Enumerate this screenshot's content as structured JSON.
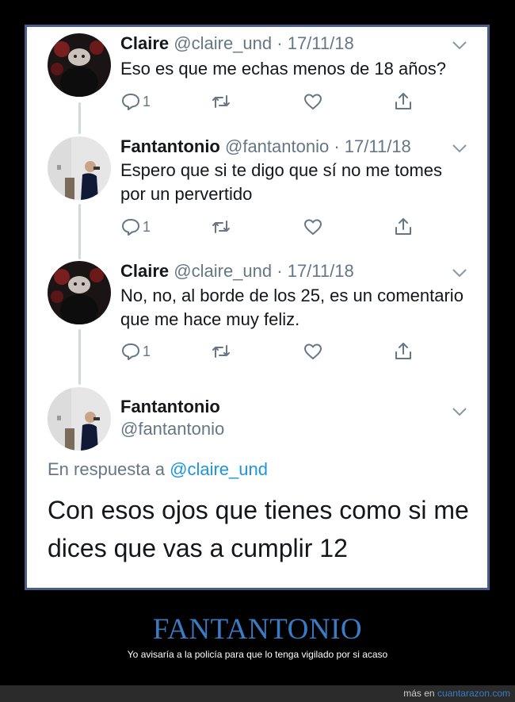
{
  "tweets": [
    {
      "name": "Claire",
      "handle": "@claire_und",
      "date": "· 17/11/18",
      "text": "Eso es que me echas menos de 18 años?",
      "reply_count": "1",
      "avatar": "claire-avatar"
    },
    {
      "name": "Fantantonio",
      "handle": "@fantantonio",
      "date": "· 17/11/18",
      "text": "Espero que si te digo que sí no me tomes por un pervertido",
      "reply_count": "1",
      "avatar": "fantantonio-avatar"
    },
    {
      "name": "Claire",
      "handle": "@claire_und",
      "date": "· 17/11/18",
      "text": "No, no, al borde de los 25, es un comentario que me hace muy feliz.",
      "reply_count": "1",
      "avatar": "claire-avatar"
    }
  ],
  "main_tweet": {
    "name": "Fantantonio",
    "handle": "@fantantonio",
    "reply_prefix": "En respuesta a",
    "reply_mention": "@claire_und",
    "text": "Con esos ojos que tienes como si me dices que vas a cumplir 12"
  },
  "footer": {
    "title": "FANTANTONIO",
    "caption": "Yo avisaría a la policía para que lo tenga vigilado por si acaso",
    "credit_prefix": "más en",
    "credit_site": "cuantarazon.com"
  },
  "colors": {
    "accent": "#1b95e0",
    "secondary_text": "#657786",
    "frame_border": "#4a5d8a",
    "footer_title": "#3a7cc4"
  },
  "icons": [
    "reply-icon",
    "retweet-icon",
    "like-icon",
    "share-icon",
    "chevron-down-icon"
  ]
}
